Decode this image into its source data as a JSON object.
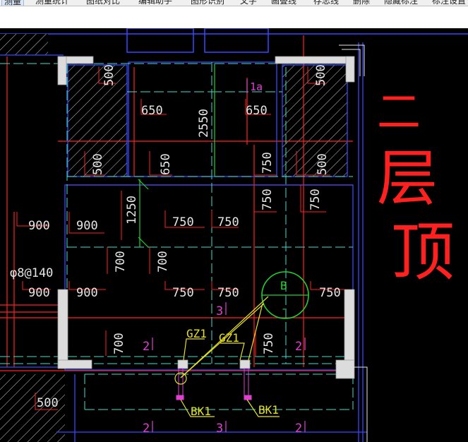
{
  "toolbar": {
    "items": [
      "测量",
      "测量统计",
      "图纸对比",
      "编辑助手",
      "图形识别",
      "文字",
      "画叠线",
      "存忠线",
      "删除",
      "隐藏标注",
      "标注设置"
    ]
  },
  "drawing": {
    "dims": {
      "d500_tl": "500",
      "d500_tr": "500",
      "d650_a": "650",
      "d2550": "2550",
      "d1a": "1a",
      "d650_b": "650",
      "d500_l": "500",
      "d650_c": "650",
      "d750_a": "750",
      "d500_r": "500",
      "d750_b": "750",
      "d750_c": "750",
      "d1250": "1250",
      "d900_a": "900",
      "d900_b": "900",
      "d750_d": "750",
      "d750_e": "750",
      "d700_a": "700",
      "d700_b": "700",
      "rebar": "φ8@140",
      "d900_c": "900",
      "d900_d": "900",
      "d750_f": "750",
      "d750_g": "750",
      "d750_h": "750",
      "n3_mid": "3",
      "gz1_a": "GZ1",
      "gz1_b": "GZ1",
      "d700_c": "700",
      "n2_l": "2",
      "d750_i": "750",
      "n2_r": "2",
      "bk1_a": "BK1",
      "bk1_b": "BK1",
      "d500_bl": "500",
      "n2_b1": "2",
      "n3_b": "3",
      "n2_b2": "2"
    },
    "axis": {
      "label": "B",
      "sub": "-"
    },
    "annotation": {
      "line1": "二",
      "line2": "层",
      "line3": "顶"
    }
  },
  "colors": {
    "background": "#000000",
    "wall": "#dcdcdc",
    "dimension": "#e6e6e6",
    "leader": "#ff2020",
    "grid_cyan": "#3fe0d0",
    "beam_blue": "#3848ff",
    "axis_green": "#22d030",
    "tag_yellow": "#e6e020",
    "number_magenta": "#e040d0",
    "handwriting": "#ff2020"
  }
}
